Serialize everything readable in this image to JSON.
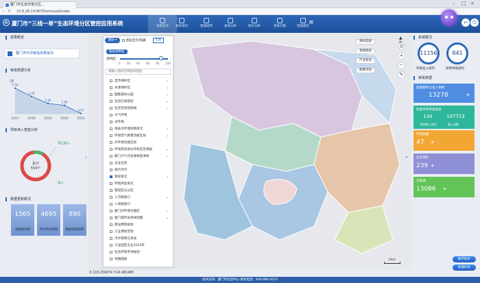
{
  "browser": {
    "tab_title": "厦门市生态环境分区...",
    "url": "10.8.28.14:8070/xmsxyd/index"
  },
  "header": {
    "logo_glyph": "⊕",
    "title": "厦门市“三线一单”生态环境分区管控应用系统",
    "nav": [
      {
        "label": "系统首页",
        "active": true
      },
      {
        "label": "基本资料",
        "active": false
      },
      {
        "label": "智能研判",
        "active": false
      },
      {
        "label": "查询分析",
        "active": false
      },
      {
        "label": "统计分析",
        "active": false
      },
      {
        "label": "系统交换",
        "active": false
      },
      {
        "label": "智能报告",
        "active": false
      }
    ],
    "menu_icon": "≡"
  },
  "left": {
    "sec1_title": "成果概览",
    "brand_link": "厦门市环评审批改革板块",
    "sec2_title": "审批数据分析",
    "chart_unit": "/天",
    "sec3_title": "项目准入智能分析",
    "donut_center_label": "总计",
    "donut_center_value": "559个",
    "donut_right_label": "禁止准入",
    "donut_bottom_label": "准入",
    "sec4_title": "数据更新概况",
    "stats": [
      {
        "value": "1565",
        "label": "总数据项目"
      },
      {
        "value": "4695",
        "label": "节约审批周期"
      },
      {
        "value": "890",
        "label": "数据管理项目"
      }
    ]
  },
  "chart_data": {
    "type": "line",
    "categories": [
      "2017",
      "2018",
      "2019",
      "2020",
      "2021"
    ],
    "values": [
      5.59,
      3.78,
      2.25,
      1.84,
      0.07
    ],
    "ylabel": "/天"
  },
  "layer_panel": {
    "dropdown": "图层",
    "show_all": "图层显示/隐藏",
    "search_btn": "检索",
    "tag": "图层透明度",
    "opacity_label": "透明度:",
    "slider_ticks": [
      "0",
      "20",
      "40",
      "60",
      "80",
      "100"
    ],
    "opacity_value": 0.85,
    "search_placeholder": "请输入图层名称查找图层",
    "layers": [
      {
        "label": "自然保护区",
        "checked": false,
        "expand": true
      },
      {
        "label": "水源保护区",
        "checked": false,
        "expand": true
      },
      {
        "label": "国家森林公园",
        "checked": false,
        "expand": true
      },
      {
        "label": "生态红线管控",
        "checked": false,
        "expand": true
      },
      {
        "label": "生态空间控制线",
        "checked": false,
        "expand": true
      },
      {
        "label": "大气环境",
        "checked": false,
        "expand": false
      },
      {
        "label": "水环境",
        "checked": false,
        "expand": false
      },
      {
        "label": "地表水环境控制单元",
        "checked": false,
        "expand": true
      },
      {
        "label": "环境空气质量功能区划",
        "checked": false,
        "expand": true
      },
      {
        "label": "声环境功能区划",
        "checked": false,
        "expand": false
      },
      {
        "label": "环境风险源分布和应急预案",
        "checked": false,
        "expand": true
      },
      {
        "label": "厦门大气污染源排放清单",
        "checked": false,
        "expand": true
      },
      {
        "label": "企业信息",
        "checked": false,
        "expand": false
      },
      {
        "label": "排污许可",
        "checked": false,
        "expand": false
      },
      {
        "label": "管控单元",
        "checked": true,
        "expand": true
      },
      {
        "label": "环境风险单元",
        "checked": false,
        "expand": false
      },
      {
        "label": "管控区与分区",
        "checked": false,
        "expand": false
      },
      {
        "label": "入河排放口",
        "checked": false,
        "expand": true
      },
      {
        "label": "入海排放口",
        "checked": false,
        "expand": false
      },
      {
        "label": "厦门声环境功能区",
        "checked": false,
        "expand": true
      },
      {
        "label": "厦门城市总体规划图",
        "checked": false,
        "expand": true
      },
      {
        "label": "建设用地规划",
        "checked": false,
        "expand": false
      },
      {
        "label": "工业用地范围",
        "checked": false,
        "expand": false
      },
      {
        "label": "污水管网与泵站",
        "checked": false,
        "expand": false
      },
      {
        "label": "工业园区企业2020年",
        "checked": false,
        "expand": false
      },
      {
        "label": "生态环境专项规划",
        "checked": false,
        "expand": false
      },
      {
        "label": "地图图层",
        "checked": false,
        "expand": false
      }
    ]
  },
  "map": {
    "tools": [
      "清除选择",
      "基础图层",
      "产业布局",
      "图像识别"
    ],
    "north": "N",
    "coords": "X:118.259074 Y:24.481485",
    "scale": "10km",
    "right_toggle": "»"
  },
  "right": {
    "sec1_title": "系统概况",
    "circle1_value": "11156",
    "circle1_label": "项目准入研判",
    "circle2_value": "841",
    "circle2_label": "项目审批研判",
    "sec2_title": "审批数据",
    "cards": [
      {
        "title": "智能研判与准入预判",
        "value": "13278",
        "color": "#4f8de2"
      },
      {
        "title": "智能环评审批系统",
        "value": "134",
        "sub_value": "107713",
        "sub1": "研判准入项目",
        "sub2": "准入总数",
        "color": "#2fb79b"
      },
      {
        "title": "环境质量",
        "value": "47",
        "color": "#f2a734"
      },
      {
        "title": "生态保护",
        "value": "239",
        "color": "#8f8fd6"
      },
      {
        "title": "污染源",
        "value": "13086",
        "color": "#62c457"
      }
    ]
  },
  "floating": {
    "btn1": "数字助手",
    "btn2": "智能问答"
  },
  "footer": "技术支持：厦门市信息中心   联系电话：400-880-2023"
}
